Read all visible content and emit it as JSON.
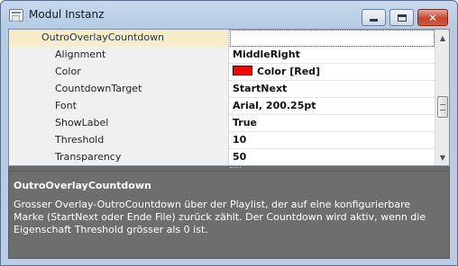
{
  "window": {
    "title": "Modul Instanz",
    "close_label": "✕"
  },
  "property_grid": {
    "category": {
      "name": "OutroOverlayCountdown",
      "expand_icon": "▾",
      "value": ""
    },
    "properties": [
      {
        "name": "Alignment",
        "value": "MiddleRight"
      },
      {
        "name": "Color",
        "value": "Color [Red]",
        "swatch_color": "#ff0000"
      },
      {
        "name": "CountdownTarget",
        "value": "StartNext"
      },
      {
        "name": "Font",
        "value": "Arial, 200.25pt"
      },
      {
        "name": "ShowLabel",
        "value": "True"
      },
      {
        "name": "Threshold",
        "value": "10"
      },
      {
        "name": "Transparency",
        "value": "50"
      }
    ],
    "scroll_up_icon": "▲",
    "scroll_down_icon": "▼"
  },
  "help": {
    "title": "OutroOverlayCountdown",
    "description": "Grosser Overlay-OutroCountdown über der Playlist, der auf eine konfigurierbare Marke (StartNext oder Ende File) zurück zählt.  Der Countdown wird aktiv, wenn die Eigenschaft Threshold grösser als 0 ist."
  }
}
